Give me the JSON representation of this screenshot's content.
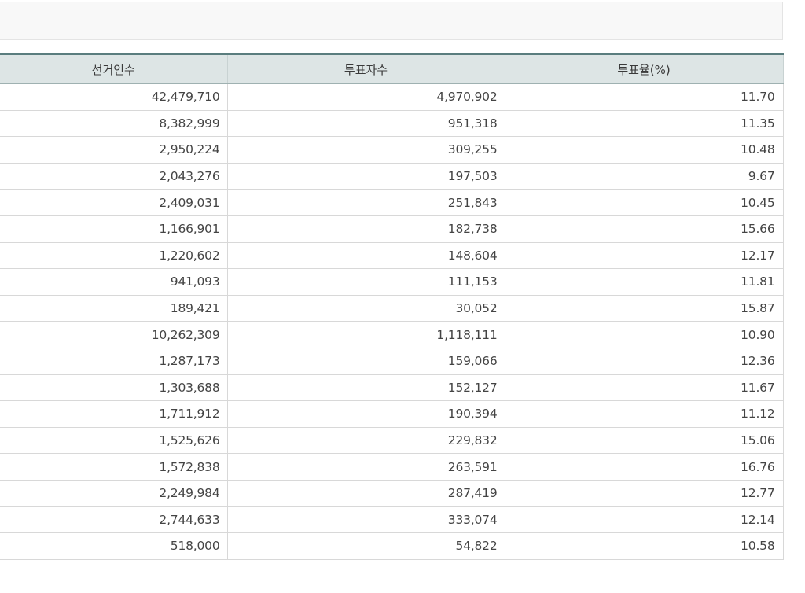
{
  "table": {
    "headers": [
      "선거인수",
      "투표자수",
      "투표율(%)"
    ],
    "rows": [
      [
        "42,479,710",
        "4,970,902",
        "11.70"
      ],
      [
        "8,382,999",
        "951,318",
        "11.35"
      ],
      [
        "2,950,224",
        "309,255",
        "10.48"
      ],
      [
        "2,043,276",
        "197,503",
        "9.67"
      ],
      [
        "2,409,031",
        "251,843",
        "10.45"
      ],
      [
        "1,166,901",
        "182,738",
        "15.66"
      ],
      [
        "1,220,602",
        "148,604",
        "12.17"
      ],
      [
        "941,093",
        "111,153",
        "11.81"
      ],
      [
        "189,421",
        "30,052",
        "15.87"
      ],
      [
        "10,262,309",
        "1,118,111",
        "10.90"
      ],
      [
        "1,287,173",
        "159,066",
        "12.36"
      ],
      [
        "1,303,688",
        "152,127",
        "11.67"
      ],
      [
        "1,711,912",
        "190,394",
        "11.12"
      ],
      [
        "1,525,626",
        "229,832",
        "15.06"
      ],
      [
        "1,572,838",
        "263,591",
        "16.76"
      ],
      [
        "2,249,984",
        "287,419",
        "12.77"
      ],
      [
        "2,744,633",
        "333,074",
        "12.14"
      ],
      [
        "518,000",
        "54,822",
        "10.58"
      ]
    ]
  }
}
